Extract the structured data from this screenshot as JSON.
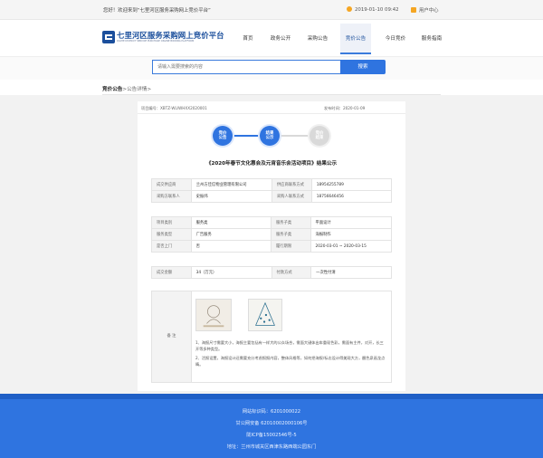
{
  "topbar": {
    "welcome": "您好！欢迎来到“七里河区服务采购网上竞价平台”",
    "datetime": "2019-01-10 09:42",
    "user_center": "用户中心"
  },
  "logo": {
    "name": "七里河区服务采购网上竞价平台",
    "subtitle": "QILIHE DISTRICT SERVICE PURCHASE ONLINE BIDDING PLATFORM"
  },
  "nav": {
    "items": [
      "首页",
      "政务公开",
      "采购公告",
      "竞价公告",
      "今日竞价",
      "服务指南"
    ],
    "active": "竞价公告"
  },
  "search": {
    "placeholder": "请输入需要搜索的内容",
    "button": "搜索"
  },
  "breadcrumb": {
    "section": "竞价公告",
    "sep": ">",
    "page": "公告详情>"
  },
  "detail": {
    "project_no": "项目编号：XBTZ-WLIWHXX2020001",
    "publish_time": "发布时间：2020-01-09",
    "steps": [
      {
        "line1": "竞价",
        "line2": "公告",
        "state": "done"
      },
      {
        "line1": "结果",
        "line2": "公示",
        "state": "done"
      },
      {
        "line1": "竞价",
        "line2": "结束",
        "state": "pending"
      }
    ],
    "title": "《2020年春节文化惠会及元宵音乐会活动项目》结果公示",
    "table1": [
      [
        "成交供应商",
        "兰州方佳信物业管理有限公司",
        "供应商联系方式",
        "18954255789"
      ],
      [
        "采购方联系人",
        "史振炜",
        "采购人联系方式",
        "18756646456"
      ]
    ],
    "table2": [
      [
        "项目类别",
        "服务类",
        "服务子类",
        "平面设计"
      ],
      [
        "服务类型",
        "广告服务",
        "服务子类",
        "海报制作"
      ],
      [
        "是否上门",
        "否",
        "履行期限",
        "2020-03-01  ~  2020-03-15"
      ]
    ],
    "table3": [
      [
        "成交金额",
        "34（万元）",
        "付款方式",
        "一次性付清"
      ]
    ],
    "remark_label": "备  注",
    "remark_lines": [
      "1、海报尺寸需要大小，海报主要包括有一样大的公众场合，需面大键体出车重现色彩，需面有主件，对开，长三开等多种类型。",
      "2、活报设置，海报设计还需要充分考虑报报内容，整体风格等，如何把海报/标志设计得美观大方，醒色泉画龙点睛。"
    ]
  },
  "footer": {
    "lines": [
      "网站标识码：6201000022",
      "甘公网安备 62010002000106号",
      "陇ICP备15002546号-5",
      "地址：兰州市城关区西津东路西端公园东门"
    ]
  },
  "colors": {
    "primary": "#2f74e0",
    "footer": "#2f74e0",
    "logo": "#1b4f9c",
    "accent": "#f5a623"
  }
}
